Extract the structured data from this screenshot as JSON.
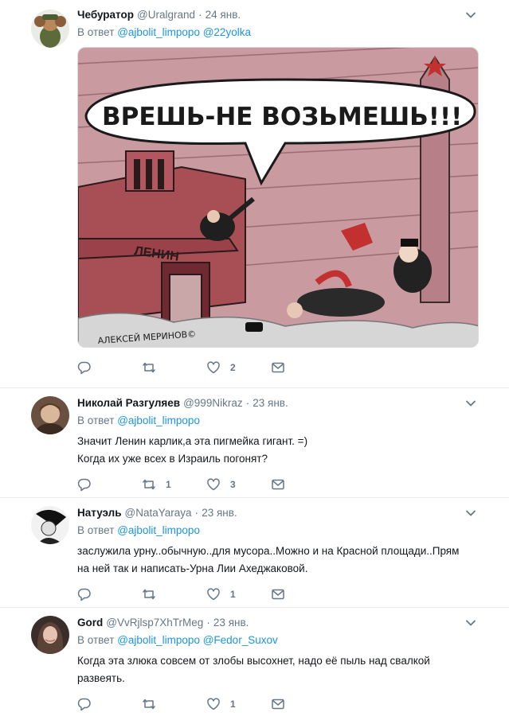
{
  "tweets": [
    {
      "name": "Чебуратор",
      "handle": "@Uralgrand",
      "time": "24 янв.",
      "reply_prefix": "В ответ",
      "reply_to": [
        "@ajbolit_limpopo",
        "@22yolka"
      ],
      "text": [],
      "image": {
        "speech": "ВРЕШЬ-НЕ ВОЗЬМЕШЬ!!!",
        "building_sign": "ЛЕНИН",
        "signature": "АЛЕКСЕЙ МЕРИНОВ©"
      },
      "counts": {
        "replies": "",
        "retweets": "",
        "likes": "2"
      }
    },
    {
      "name": "Николай Разгуляев",
      "handle": "@999Nikraz",
      "time": "23 янв.",
      "reply_prefix": "В ответ",
      "reply_to": [
        "@ajbolit_limpopo"
      ],
      "text": [
        "Значит Ленин карлик,а эта пигмейка гигант.   =)",
        "Когда их уже всех в Израиль погонят?"
      ],
      "counts": {
        "replies": "",
        "retweets": "1",
        "likes": "3"
      }
    },
    {
      "name": "Натуэль",
      "handle": "@NataYaraya",
      "time": "23 янв.",
      "reply_prefix": "В ответ",
      "reply_to": [
        "@ajbolit_limpopo"
      ],
      "text": [
        "заслужила урну..обычную..для мусора..Можно и на Красной площади..Прям",
        "на ней так и написать-Урна Лии Ахеджаковой."
      ],
      "counts": {
        "replies": "",
        "retweets": "",
        "likes": "1"
      }
    },
    {
      "name": "Gord",
      "handle": "@VvRjlsp7XhTrMeg",
      "time": "23 янв.",
      "reply_prefix": "В ответ",
      "reply_to": [
        "@ajbolit_limpopo",
        "@Fedor_Suxov"
      ],
      "text": [
        "Когда эта злюка совсем от злобы высохнет, надо её пыль над свалкой",
        "развеять."
      ],
      "counts": {
        "replies": "",
        "retweets": "",
        "likes": "1"
      }
    }
  ],
  "colors": {
    "link": "#1b95e0",
    "muted": "#657786",
    "divider": "#e6ecf0"
  },
  "icons": [
    "reply-icon",
    "retweet-icon",
    "like-icon",
    "dm-icon",
    "chevron-down-icon"
  ]
}
